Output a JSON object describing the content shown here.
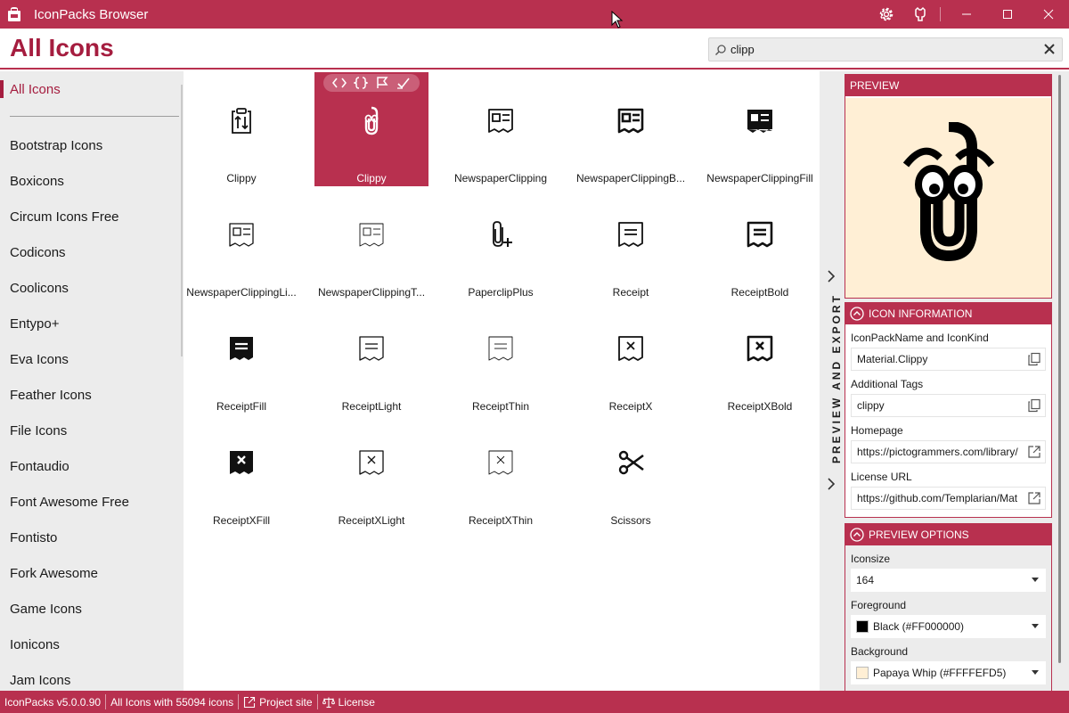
{
  "app": {
    "title": "IconPacks Browser",
    "accent": "#b8304f",
    "accent_dark": "#a51d3f"
  },
  "titlebar": {
    "buttons": [
      {
        "name": "settings-icon"
      },
      {
        "name": "github-icon"
      },
      {
        "name": "minimize-icon"
      },
      {
        "name": "maximize-icon"
      },
      {
        "name": "close-icon"
      }
    ]
  },
  "header": {
    "page_title": "All Icons",
    "search": {
      "value": "clipp",
      "placeholder": ""
    }
  },
  "sidebar": {
    "active": "All Icons",
    "items": [
      "Bootstrap Icons",
      "Boxicons",
      "Circum Icons Free",
      "Codicons",
      "Coolicons",
      "Entypo+",
      "Eva Icons",
      "Feather Icons",
      "File Icons",
      "Fontaudio",
      "Font Awesome Free",
      "Fontisto",
      "Fork Awesome",
      "Game Icons",
      "Ionicons",
      "Jam Icons"
    ]
  },
  "grid": {
    "selected_index": 1,
    "cell_toolbar_icons": [
      "code-icon",
      "braces-icon",
      "flag-icon",
      "check-icon"
    ],
    "icons": [
      {
        "label": "Clippy",
        "icon": "clipboard-arrows-icon"
      },
      {
        "label": "Clippy",
        "icon": "clippy-icon"
      },
      {
        "label": "NewspaperClipping",
        "icon": "newspaper-clipping-icon"
      },
      {
        "label": "NewspaperClippingB...",
        "icon": "newspaper-clipping-bold-icon"
      },
      {
        "label": "NewspaperClippingFill",
        "icon": "newspaper-clipping-fill-icon"
      },
      {
        "label": "NewspaperClippingLi...",
        "icon": "newspaper-clipping-light-icon"
      },
      {
        "label": "NewspaperClippingT...",
        "icon": "newspaper-clipping-thin-icon"
      },
      {
        "label": "PaperclipPlus",
        "icon": "paperclip-plus-icon"
      },
      {
        "label": "Receipt",
        "icon": "receipt-icon"
      },
      {
        "label": "ReceiptBold",
        "icon": "receipt-bold-icon"
      },
      {
        "label": "ReceiptFill",
        "icon": "receipt-fill-icon"
      },
      {
        "label": "ReceiptLight",
        "icon": "receipt-light-icon"
      },
      {
        "label": "ReceiptThin",
        "icon": "receipt-thin-icon"
      },
      {
        "label": "ReceiptX",
        "icon": "receipt-x-icon"
      },
      {
        "label": "ReceiptXBold",
        "icon": "receipt-x-bold-icon"
      },
      {
        "label": "ReceiptXFill",
        "icon": "receipt-x-fill-icon"
      },
      {
        "label": "ReceiptXLight",
        "icon": "receipt-x-light-icon"
      },
      {
        "label": "ReceiptXThin",
        "icon": "receipt-x-thin-icon"
      },
      {
        "label": "Scissors",
        "icon": "scissors-icon"
      }
    ]
  },
  "side_panel": {
    "label": "PREVIEW AND EXPORT"
  },
  "preview": {
    "header": "PREVIEW",
    "background": "#FFEFD5",
    "foreground": "#000000"
  },
  "icon_info": {
    "header": "ICON INFORMATION",
    "fields": [
      {
        "label": "IconPackName and IconKind",
        "value": "Material.Clippy",
        "button": "copy-icon"
      },
      {
        "label": "Additional Tags",
        "value": "clippy",
        "button": "copy-icon"
      },
      {
        "label": "Homepage",
        "value": "https://pictogrammers.com/library/",
        "button": "external-link-icon"
      },
      {
        "label": "License URL",
        "value": "https://github.com/Templarian/Mat",
        "button": "external-link-icon"
      }
    ]
  },
  "preview_options": {
    "header": "PREVIEW OPTIONS",
    "iconsize_label": "Iconsize",
    "iconsize_value": "164",
    "foreground_label": "Foreground",
    "foreground_value": "Black (#FF000000)",
    "foreground_color": "#000000",
    "background_label": "Background",
    "background_value": "Papaya Whip (#FFFFEFD5)",
    "background_color": "#FFEFD5"
  },
  "statusbar": {
    "version": "IconPacks v5.0.0.90",
    "count": "All Icons with 55094 icons",
    "project_site": "Project site",
    "license": "License"
  }
}
